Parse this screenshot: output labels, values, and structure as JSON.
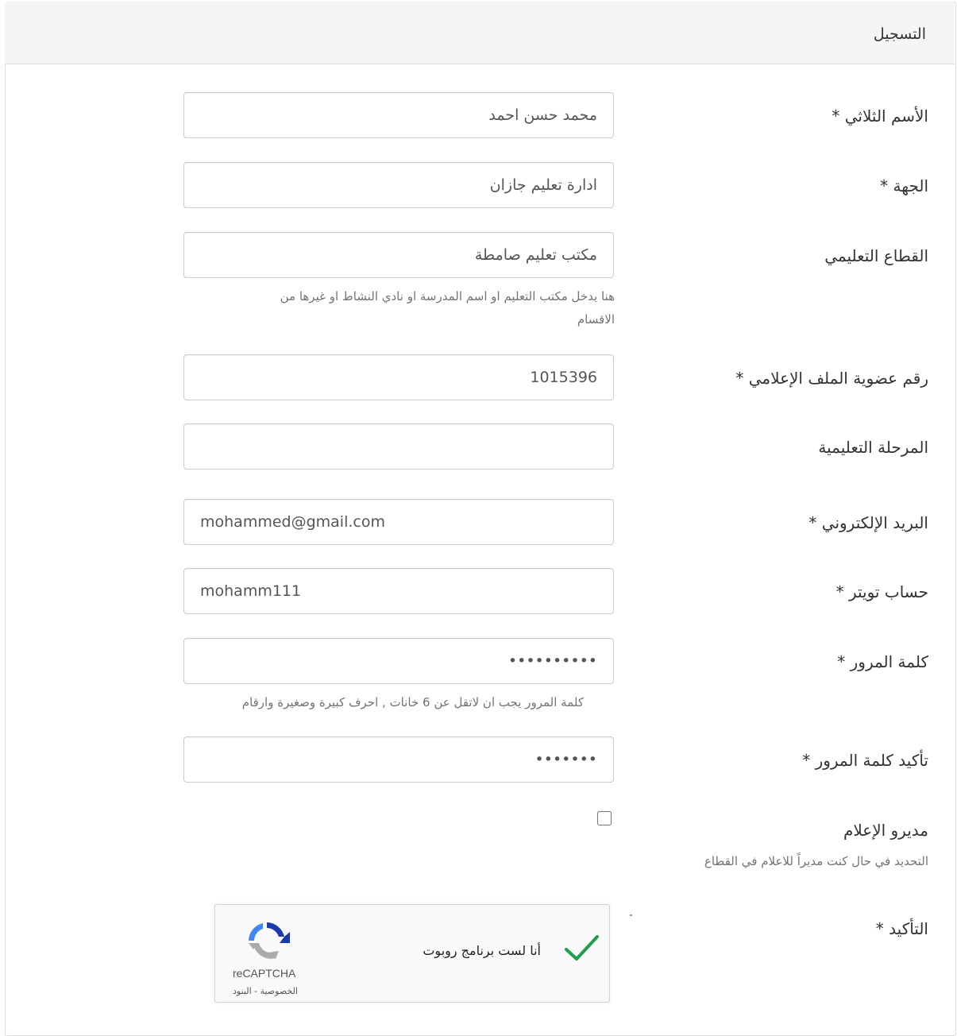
{
  "panel": {
    "title": "التسجيل"
  },
  "form": {
    "full_name": {
      "label": "الأسم الثلاثي *",
      "value": "محمد حسن احمد"
    },
    "entity": {
      "label": "الجهة *",
      "value": "ادارة تعليم جازان"
    },
    "sector": {
      "label": "القطاع التعليمي",
      "value": "مكتب تعليم صامطة",
      "help_line1": "هنا يدخل مكتب التعليم او اسم المدرسة او نادي النشاط او غيرها من",
      "help_line2": "الاقسام"
    },
    "membership": {
      "label": "رقم عضوية الملف الإعلامي *",
      "value": "1015396"
    },
    "stage": {
      "label": "المرحلة التعليمية",
      "value": ""
    },
    "email": {
      "label": "البريد الإلكتروني *",
      "value": "mohammed@gmail.com"
    },
    "twitter": {
      "label": "حساب تويتر *",
      "value": "mohamm111"
    },
    "password": {
      "label": "كلمة المرور *",
      "value": "0123456789",
      "help": "كلمة المرور يجب ان لاتقل عن 6 خانات , احرف كبيرة وصغيرة وارقام"
    },
    "confirm_password": {
      "label": "تأكيد كلمة المرور *",
      "value": "0123456"
    },
    "media_manager": {
      "label": "مديرو الإعلام",
      "help": "التحديد في حال كنت مديراً للاعلام في القطاع",
      "checked": false
    },
    "confirmation": {
      "label": "التأكيد *"
    }
  },
  "recaptcha": {
    "text": "أنا لست برنامج روبوت",
    "brand": "reCAPTCHA",
    "links": "الخصوصية - البنود",
    "check_color": "#1e9e4a"
  }
}
